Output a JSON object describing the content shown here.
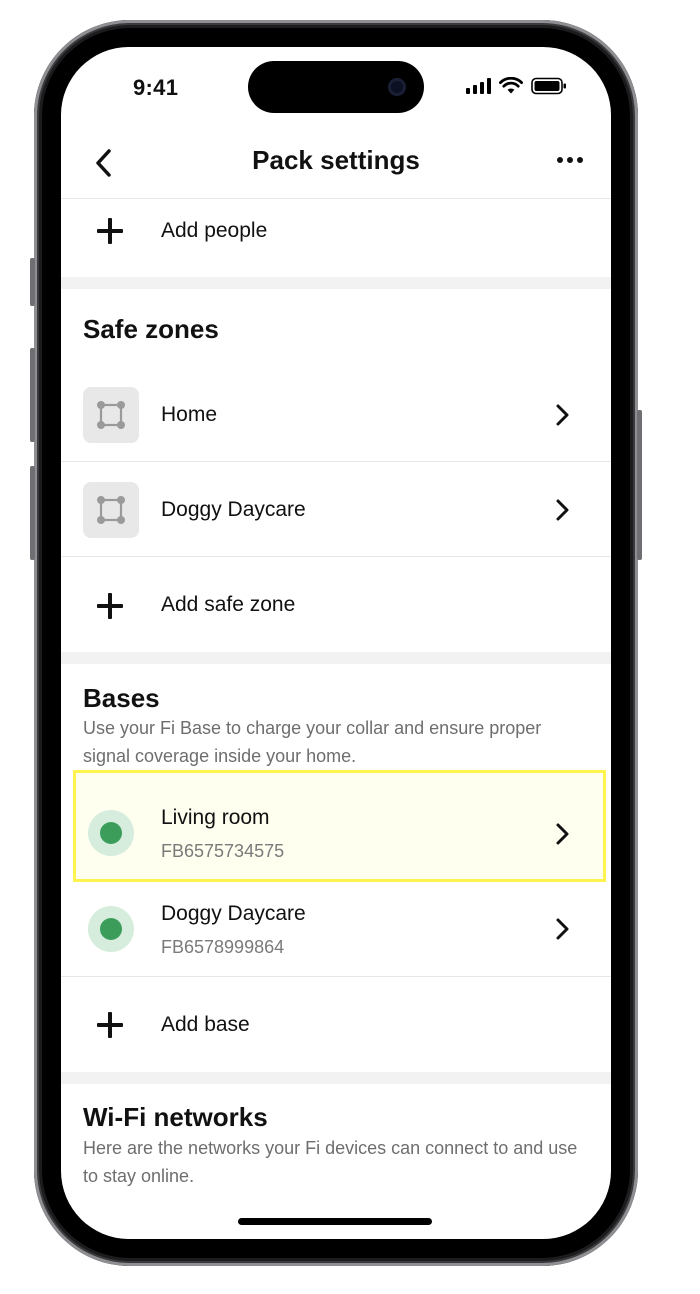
{
  "status_bar": {
    "time": "9:41",
    "icons": [
      "signal-icon",
      "wifi-icon",
      "battery-icon"
    ]
  },
  "nav": {
    "title": "Pack settings",
    "back_icon": "chevron-left-icon",
    "more_icon": "more-horizontal-icon"
  },
  "people": {
    "add_label": "Add people"
  },
  "safe_zones": {
    "title": "Safe zones",
    "items": [
      {
        "label": "Home",
        "icon": "zone-shape-icon"
      },
      {
        "label": "Doggy Daycare",
        "icon": "zone-shape-icon"
      }
    ],
    "add_label": "Add safe zone"
  },
  "bases": {
    "title": "Bases",
    "description": "Use your Fi Base to charge your collar and ensure proper signal coverage inside your home.",
    "items": [
      {
        "label": "Living room",
        "serial": "FB6575734575",
        "status": "online",
        "highlighted": true
      },
      {
        "label": "Doggy Daycare",
        "serial": "FB6578999864",
        "status": "online",
        "highlighted": false
      }
    ],
    "add_label": "Add base"
  },
  "wifi": {
    "title": "Wi-Fi networks",
    "description": "Here are the networks your Fi devices can connect to and use to stay online."
  },
  "colors": {
    "status_online": "#3c9d5a",
    "highlight_border": "#fff44f",
    "highlight_fill": "#fffff0"
  }
}
